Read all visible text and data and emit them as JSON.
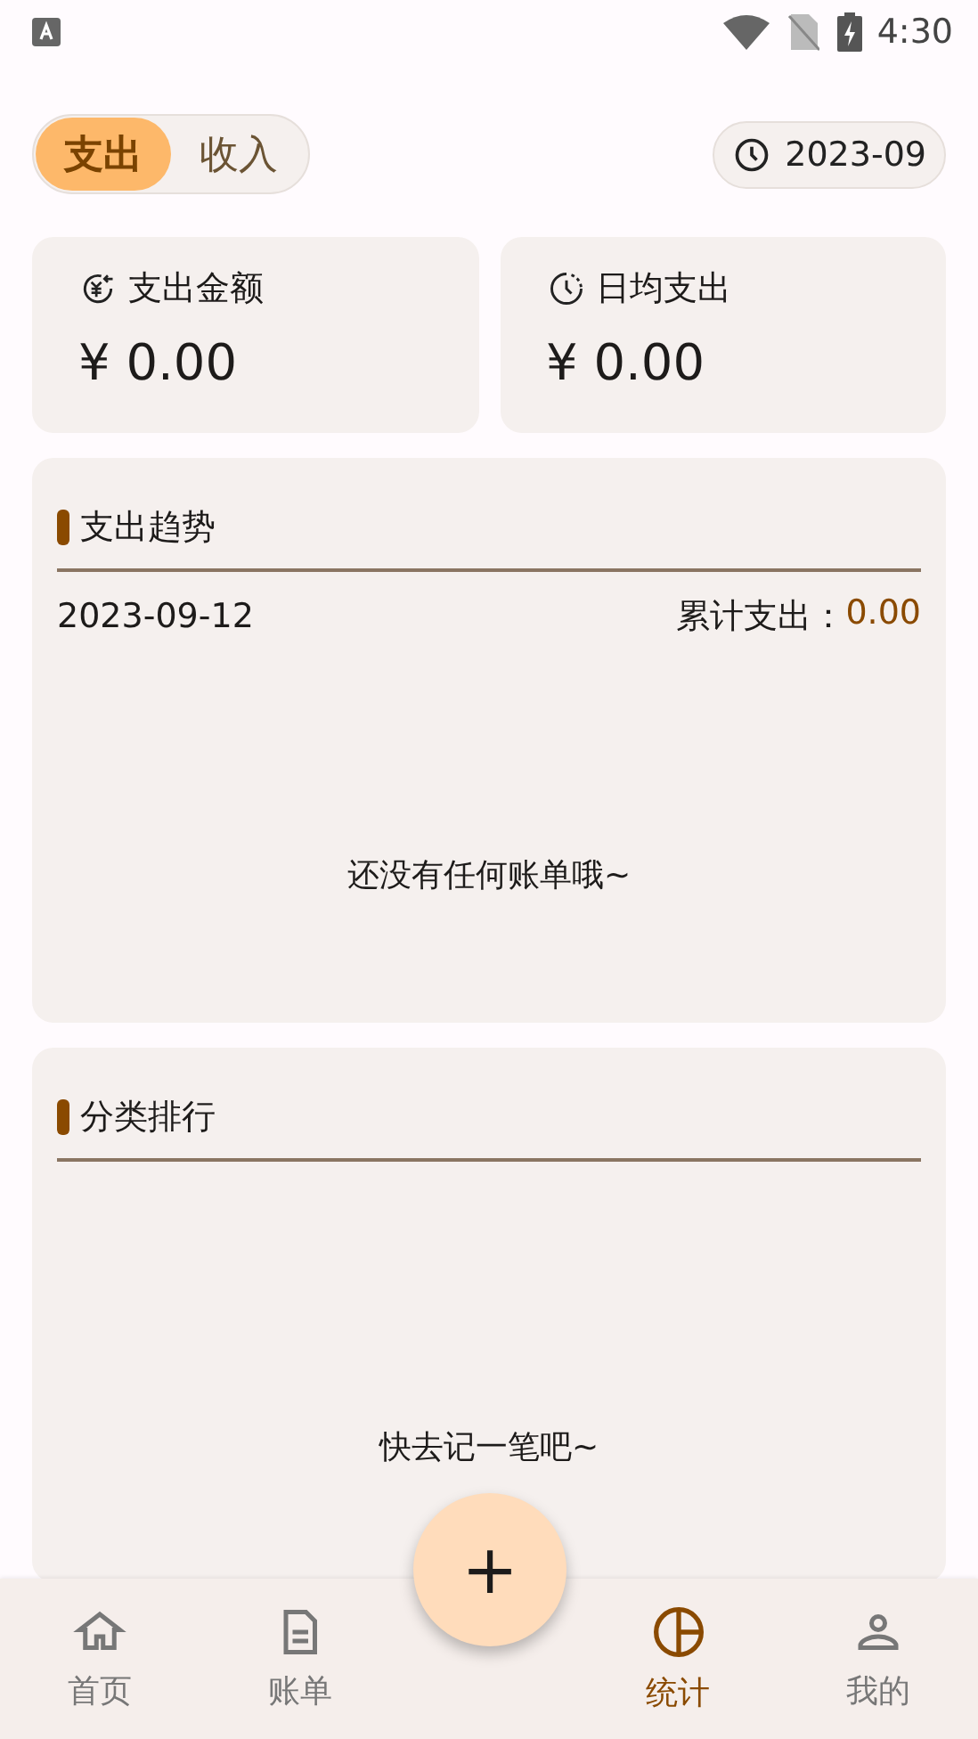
{
  "status_bar": {
    "time": "4:30"
  },
  "type_tabs": [
    {
      "label": "支出",
      "selected": true
    },
    {
      "label": "收入",
      "selected": false
    }
  ],
  "month_picker": {
    "value": "2023-09"
  },
  "summary_cards": [
    {
      "kind": "total",
      "title": "支出金额",
      "value": "¥ 0.00"
    },
    {
      "kind": "daily",
      "title": "日均支出",
      "value": "¥ 0.00"
    }
  ],
  "trend": {
    "title": "支出趋势",
    "date": "2023-09-12",
    "total_label": "累计支出：",
    "total_value": "0.00",
    "empty_text": "还没有任何账单哦~"
  },
  "ranking": {
    "title": "分类排行",
    "empty_text": "快去记一笔吧~"
  },
  "fab": {
    "label": "+"
  },
  "nav": [
    {
      "kind": "home",
      "label": "首页",
      "selected": false
    },
    {
      "kind": "bill",
      "label": "账单",
      "selected": false
    },
    {
      "kind": "stats",
      "label": "统计",
      "selected": true
    },
    {
      "kind": "me",
      "label": "我的",
      "selected": false
    }
  ]
}
